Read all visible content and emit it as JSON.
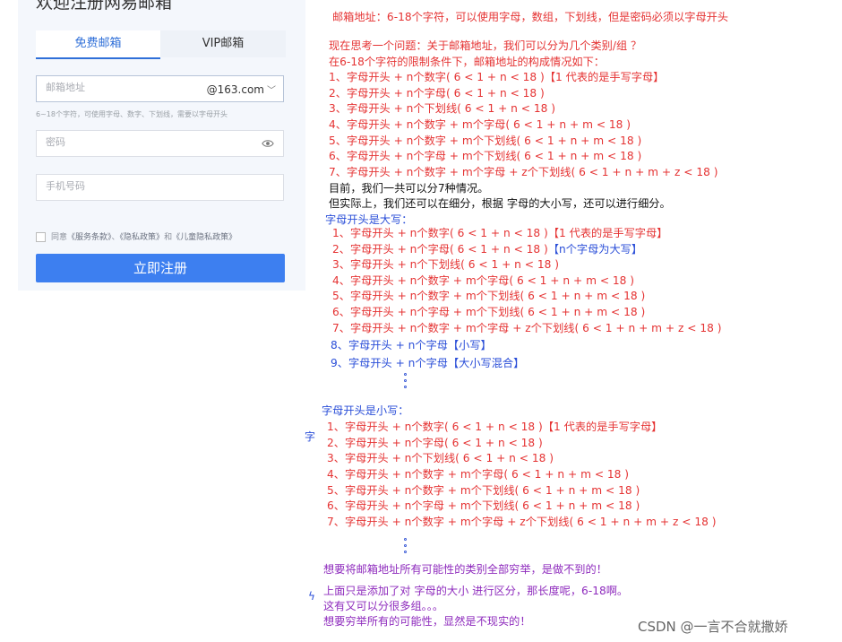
{
  "form": {
    "title": "欢迎注册网易邮箱",
    "tabs": [
      "免费邮箱",
      "VIP邮箱"
    ],
    "email_placeholder": "邮箱地址",
    "domain": "@163.com",
    "hint": "6~18个字符，可使用字母、数字、下划线，需要以字母开头",
    "password_placeholder": "密码",
    "phone_placeholder": "手机号码",
    "agree_prefix": "同意",
    "agree_link1": "《服务条款》",
    "agree_sep1": "、",
    "agree_link2": "《隐私政策》",
    "agree_sep2": "和",
    "agree_link3": "《儿童隐私政策》",
    "submit_label": "立即注册"
  },
  "notes": {
    "rule": "邮箱地址：6-18个字符，可以使用字母，数组，下划线，但是密码必须以字母开头",
    "question": "现在思考一个问题：关于邮箱地址，我们可以分为几个类别/组 ？",
    "intro": "在6-18个字符的限制条件下，邮箱地址的构成情况如下：",
    "group1": [
      "1、字母开头 + n个数字( 6 < 1 + n < 18 )【1 代表的是手写字母】",
      "2、字母开头 + n个字母( 6 < 1 + n < 18 )",
      "3、字母开头 + n个下划线( 6 < 1 + n < 18 )",
      "4、字母开头 + n个数字 + m个字母( 6 < 1 + n + m < 18 )",
      "5、字母开头 + n个数字 + m个下划线( 6 < 1 + n + m < 18 )",
      "6、字母开头 + n个字母 + m个下划线( 6 < 1 + n + m < 18 )",
      "7、字母开头 + n个数字 + m个字母 + z个下划线( 6 < 1 + n + m + z < 18 )"
    ],
    "summary1": "目前，我们一共可以分7种情况。",
    "summary2": "但实际上，我们还可以在细分，根据 字母的大小写，还可以进行细分。",
    "upper_heading": "字母开头是大写：",
    "group2": [
      "1、字母开头 + n个数字( 6 < 1 + n < 18 )【1 代表的是手写字母】",
      "2、字母开头 + n个字母( 6 < 1 + n < 18 )",
      "3、字母开头 + n个下划线( 6 < 1 + n < 18 )",
      "4、字母开头 + n个数字 + m个字母( 6 < 1 + n + m < 18 )",
      "5、字母开头 + n个数字 + m个下划线( 6 < 1 + n + m < 18 )",
      "6、字母开头 + n个字母 + m个下划线( 6 < 1 + n + m < 18 )",
      "7、字母开头 + n个数字 + m个字母 + z个下划线( 6 < 1 + n + m + z < 18 )"
    ],
    "group2_line2_tag": "【n个字母为大写】",
    "extra8": "8、字母开头 + n个字母【小写】",
    "extra9": "9、字母开头 + n个字母【大小写混合】",
    "lower_heading": "字母开头是小写：",
    "group3": [
      "1、字母开头 + n个数字( 6 < 1 + n < 18 )【1 代表的是手写字母】",
      "2、字母开头 + n个字母( 6 < 1 + n < 18 )",
      "3、字母开头 + n个下划线( 6 < 1 + n < 18 )",
      "4、字母开头 + n个数字 + m个字母( 6 < 1 + n + m < 18 )",
      "5、字母开头 + n个数字 + m个下划线( 6 < 1 + n + m < 18 )",
      "6、字母开头 + n个字母 + m个下划线( 6 < 1 + n + m < 18 )",
      "7、字母开头 + n个数字 + m个字母 + z个下划线( 6 < 1 + n + m + z < 18 )"
    ],
    "conclusion1": "想要将邮箱地址所有可能性的类别全部穷举，是做不到的！",
    "conclusion2": "上面只是添加了对 字母的大小 进行区分，那长度呢，6-18啊。",
    "conclusion3": "这有又可以分很多组。。。",
    "conclusion4": "想要穷举所有的可能性，显然是不现实的！"
  },
  "watermark": "CSDN @一言不合就撒娇",
  "colors": {
    "accent": "#3d7ff0",
    "note_red": "#e53333",
    "note_blue": "#2a4ed8",
    "note_purple": "#8e2bbd"
  }
}
